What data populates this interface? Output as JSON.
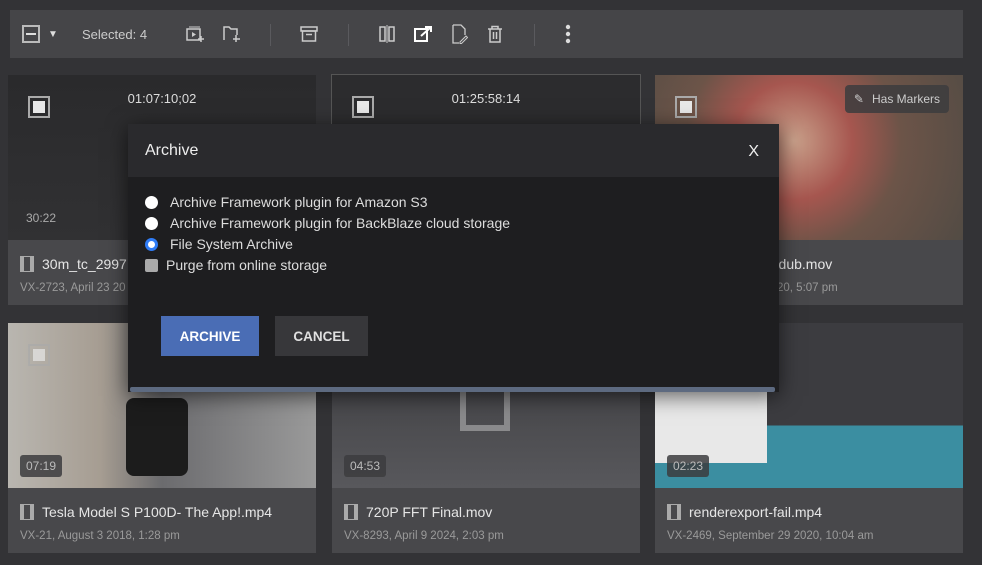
{
  "toolbar": {
    "selected_label": "Selected: 4",
    "icons": [
      "select-toggle-icon",
      "dropdown-arrow-icon",
      "add-to-collection-icon",
      "add-folder-icon",
      "archive-icon",
      "compare-icon",
      "export-icon",
      "edit-metadata-icon",
      "trash-icon",
      "more-vertical-icon"
    ]
  },
  "cards": [
    {
      "timecode": "01:07:10;02",
      "duration": "30:22",
      "name": "30m_tc_2997",
      "meta": "VX-2723, April 23 20",
      "selected": true
    },
    {
      "timecode": "01:25:58:14",
      "duration": "",
      "name": "",
      "meta": "",
      "selected": false
    },
    {
      "badge": "Has Markers",
      "duration": "",
      "name": "_1080p_auto_dub.mov",
      "meta": "20, 5:07 pm",
      "selected": true
    },
    {
      "duration": "07:19",
      "name": "Tesla Model S P100D- The App!.mp4",
      "meta": "VX-21, August 3 2018, 1:28 pm",
      "selected": true
    },
    {
      "duration": "04:53",
      "name": "720P FFT Final.mov",
      "meta": "VX-8293, April 9 2024, 2:03 pm",
      "selected": false
    },
    {
      "duration": "02:23",
      "name": "renderexport-fail.mp4",
      "meta": "VX-2469, September 29 2020, 10:04 am",
      "selected": false
    }
  ],
  "dialog": {
    "title": "Archive",
    "close": "X",
    "options": [
      {
        "label": "Archive Framework plugin for Amazon S3",
        "checked": false
      },
      {
        "label": "Archive Framework plugin for BackBlaze cloud storage",
        "checked": false
      },
      {
        "label": "File System Archive",
        "checked": true
      }
    ],
    "purge_label": "Purge from online storage",
    "archive_button": "ARCHIVE",
    "cancel_button": "CANCEL",
    "accent": "#4a6db5"
  }
}
